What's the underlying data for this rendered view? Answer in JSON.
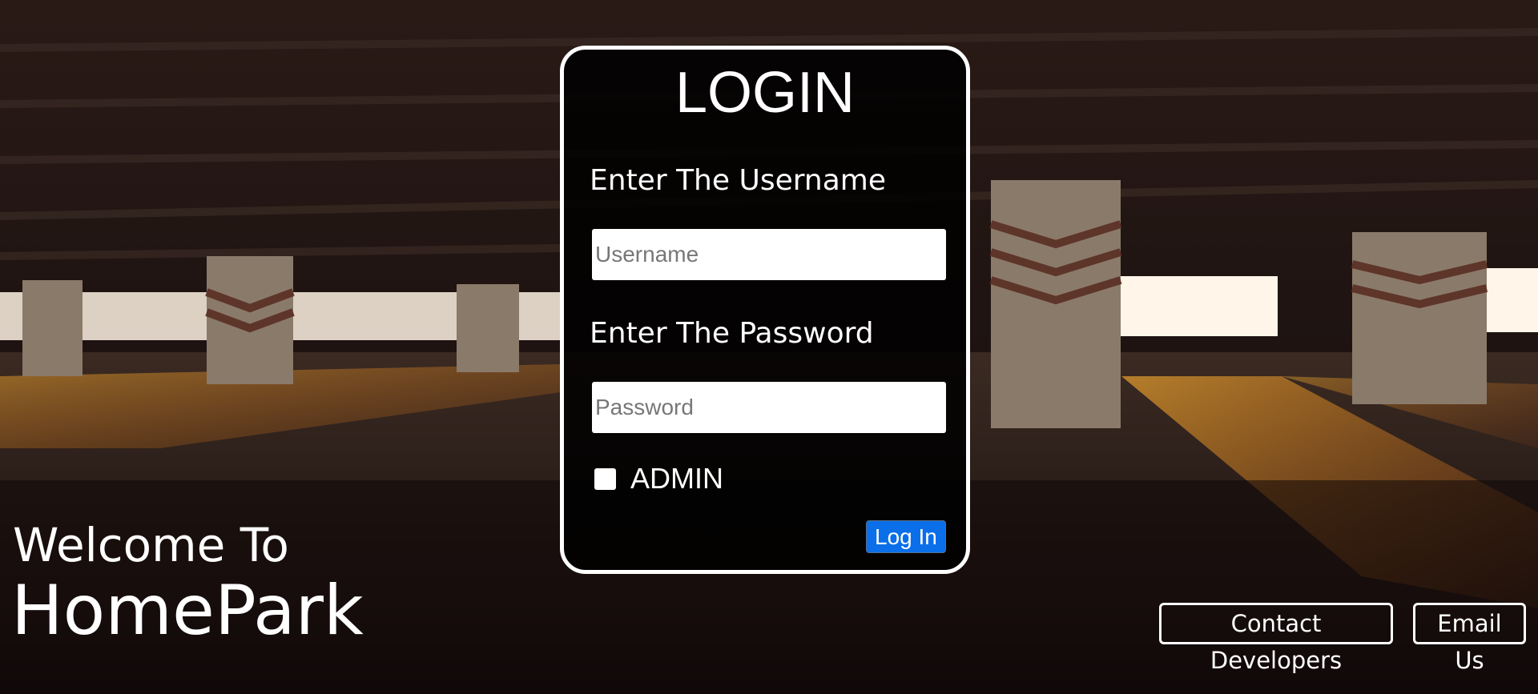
{
  "login": {
    "title": "LOGIN",
    "username_label": "Enter The Username",
    "username_placeholder": "Username",
    "username_value": "",
    "password_label": "Enter The Password",
    "password_placeholder": "Password",
    "password_value": "",
    "admin_label": "ADMIN",
    "admin_checked": false,
    "submit_label": "Log In"
  },
  "branding": {
    "welcome": "Welcome To",
    "name": "HomePark"
  },
  "footer": {
    "contact_label": "Contact Developers",
    "email_label": "Email Us"
  },
  "colors": {
    "accent": "#0a6fe8",
    "card_border": "#ffffff",
    "text": "#ffffff"
  },
  "icons": {
    "background": "parking-garage-photo"
  }
}
